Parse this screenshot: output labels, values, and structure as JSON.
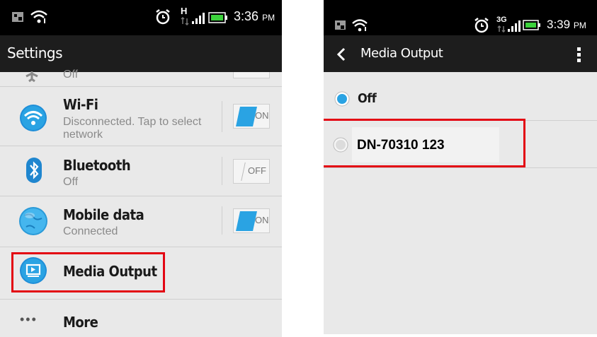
{
  "left": {
    "status": {
      "time": "3:36",
      "ampm": "PM",
      "network": "H"
    },
    "title": "Settings",
    "partial_row": {
      "subtitle": "Off"
    },
    "rows": [
      {
        "title": "Wi-Fi",
        "subtitle_line1": "Disconnected. Tap to select",
        "subtitle_line2": "network",
        "toggle": "ON"
      },
      {
        "title": "Bluetooth",
        "subtitle": "Off",
        "toggle": "OFF"
      },
      {
        "title": "Mobile data",
        "subtitle": "Connected",
        "toggle": "ON"
      },
      {
        "title": "Media Output"
      },
      {
        "title": "More",
        "icon": "•••"
      }
    ]
  },
  "right": {
    "status": {
      "time": "3:39",
      "ampm": "PM",
      "network": "3G"
    },
    "title": "Media Output",
    "options": [
      {
        "label": "Off",
        "selected": true
      },
      {
        "label": "DN-70310 123",
        "selected": false
      }
    ]
  },
  "colors": {
    "accent": "#2aa3e3",
    "highlight": "#e30613",
    "bar": "#000000",
    "background": "#e9e9e9"
  }
}
